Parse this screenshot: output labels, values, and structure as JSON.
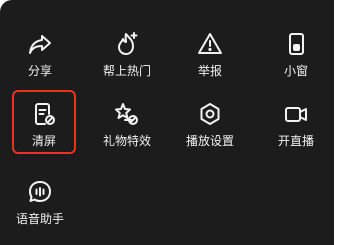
{
  "menu": {
    "row1": [
      {
        "label": "分享",
        "icon": "share-icon"
      },
      {
        "label": "帮上热门",
        "icon": "hot-flame-icon"
      },
      {
        "label": "举报",
        "icon": "warning-icon"
      },
      {
        "label": "小窗",
        "icon": "mini-window-icon"
      }
    ],
    "row2": [
      {
        "label": "清屏",
        "icon": "clear-screen-icon"
      },
      {
        "label": "礼物特效",
        "icon": "gift-effect-icon"
      },
      {
        "label": "播放设置",
        "icon": "play-settings-icon"
      },
      {
        "label": "开直播",
        "icon": "go-live-icon"
      }
    ],
    "row3": [
      {
        "label": "语音助手",
        "icon": "voice-assistant-icon"
      }
    ]
  },
  "colors": {
    "panel_bg": "#1c1c1c",
    "text": "#f2f2f2",
    "highlight_border": "#e8331e"
  }
}
